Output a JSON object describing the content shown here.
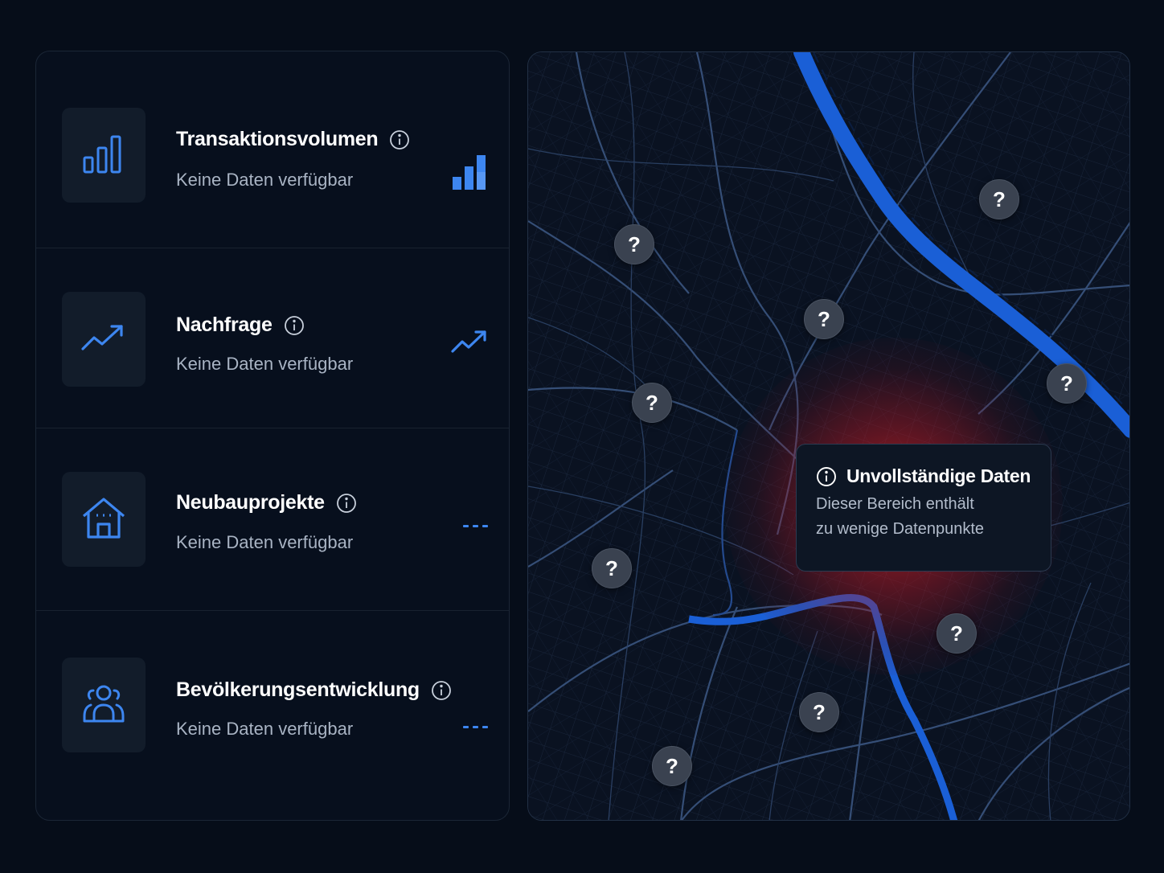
{
  "metrics": [
    {
      "title": "Transaktionsvolumen",
      "subtitle": "Keine Daten verfügbar",
      "icon": "bar-chart-icon",
      "trend": "bar-chart-icon"
    },
    {
      "title": "Nachfrage",
      "subtitle": "Keine Daten verfügbar",
      "icon": "trending-up-icon",
      "trend": "trending-up-icon"
    },
    {
      "title": "Neubauprojekte",
      "subtitle": "Keine Daten verfügbar",
      "icon": "house-icon",
      "trend": "dashed-line-icon"
    },
    {
      "title": "Bevölkerungsentwicklung",
      "subtitle": "Keine Daten verfügbar",
      "icon": "people-icon",
      "trend": "dashed-line-icon"
    }
  ],
  "map": {
    "pin_symbol": "?",
    "pin_count": 10,
    "highlight_color": "#e02828",
    "river_color": "#1a5fd6",
    "tooltip": {
      "title": "Unvollständige Daten",
      "line1": "Dieser Bereich enthält",
      "line2": "zu wenige Datenpunkte"
    }
  },
  "colors": {
    "background": "#060d19",
    "accent": "#3d86f0",
    "text_primary": "#ffffff",
    "text_secondary": "#a9b4c4"
  }
}
